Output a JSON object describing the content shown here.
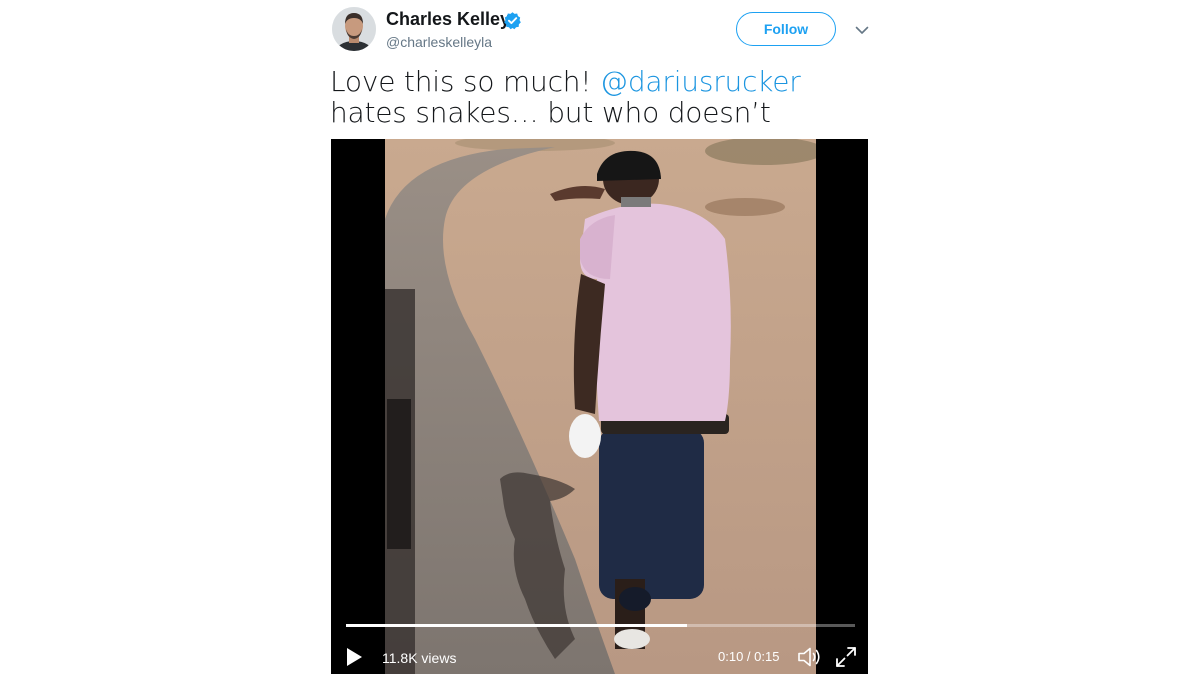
{
  "author": {
    "name": "Charles Kelley",
    "handle": "@charleskelleyla",
    "verified": true,
    "avatar_icon": "profile-photo"
  },
  "actions": {
    "follow_label": "Follow",
    "menu_icon": "chevron-down-icon"
  },
  "tweet": {
    "text_before": "Love this so much! ",
    "mention": "@dariusrucker",
    "text_after": " hates snakes… but who doesn’t"
  },
  "video": {
    "views": "11.8K views",
    "time": "0:10 / 0:15",
    "progress": 0.67,
    "play_icon": "play-icon",
    "volume_icon": "volume-icon",
    "fullscreen_icon": "fullscreen-icon"
  },
  "colors": {
    "accent": "#1da1f2",
    "mention": "#1b95e0",
    "name": "#14171a",
    "handle": "#657786"
  }
}
